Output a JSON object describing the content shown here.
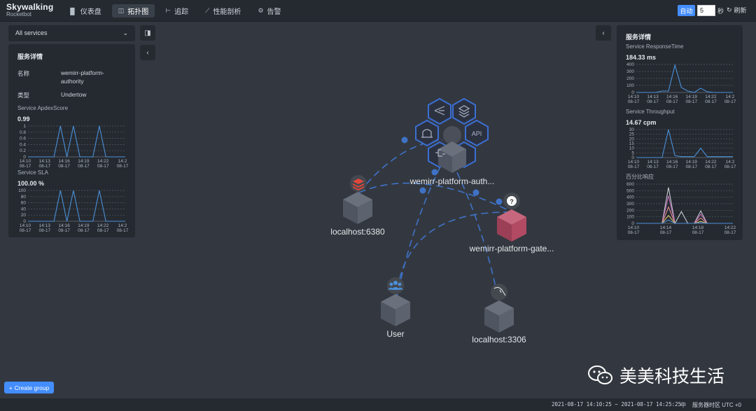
{
  "app": {
    "logo_main": "Skywalking",
    "logo_sub": "Rocketbot"
  },
  "nav": [
    {
      "label": "仪表盘",
      "icon": "bar-chart-icon",
      "glyph": "▐▌",
      "active": false
    },
    {
      "label": "拓扑图",
      "icon": "topology-icon",
      "glyph": "◫",
      "active": true
    },
    {
      "label": "追踪",
      "icon": "trace-icon",
      "glyph": "⊢",
      "active": false
    },
    {
      "label": "性能剖析",
      "icon": "profile-icon",
      "glyph": "⟋",
      "active": false
    },
    {
      "label": "告警",
      "icon": "alarm-icon",
      "glyph": "⚙",
      "active": false
    }
  ],
  "toolbar": {
    "auto_label": "自动",
    "interval_value": "5",
    "seconds_label": "秒",
    "refresh_label": "刷新"
  },
  "left": {
    "select_value": "All services",
    "title": "服务详情",
    "name_key": "名称",
    "name_value_1": "wemirr-platform-",
    "name_value_2": "authority",
    "type_key": "类型",
    "type_value": "Undertow",
    "apdex_label": "Service ApdexScore",
    "apdex_value": "0.99",
    "apdex_yticks": [
      "1",
      "0.8",
      "0.6",
      "0.4",
      "0.2",
      "0"
    ],
    "sla_label": "Service SLA",
    "sla_value": "100.00 %",
    "sla_yticks": [
      "100",
      "80",
      "60",
      "40",
      "20",
      "0"
    ],
    "xticks": [
      "14:10",
      "14:13",
      "14:16",
      "14:19",
      "14:22",
      "14:2"
    ],
    "xdate": "08-17"
  },
  "chart_data": [
    {
      "type": "line",
      "title": "Service ApdexScore",
      "x": [
        "14:10",
        "14:11",
        "14:12",
        "14:13",
        "14:14",
        "14:15",
        "14:16",
        "14:17",
        "14:18",
        "14:19",
        "14:20",
        "14:21",
        "14:22",
        "14:23",
        "14:24",
        "14:25"
      ],
      "values": [
        0,
        0,
        0,
        0,
        0,
        1,
        0,
        1,
        0,
        0,
        0,
        1,
        0,
        0,
        0,
        0
      ],
      "ylim": [
        0,
        1
      ]
    },
    {
      "type": "line",
      "title": "Service SLA",
      "x": [
        "14:10",
        "14:11",
        "14:12",
        "14:13",
        "14:14",
        "14:15",
        "14:16",
        "14:17",
        "14:18",
        "14:19",
        "14:20",
        "14:21",
        "14:22",
        "14:23",
        "14:24",
        "14:25"
      ],
      "values": [
        0,
        0,
        0,
        0,
        0,
        100,
        0,
        100,
        0,
        0,
        0,
        100,
        0,
        0,
        0,
        0
      ],
      "ylim": [
        0,
        100
      ]
    },
    {
      "type": "line",
      "title": "Service ResponseTime",
      "x": [
        "14:10",
        "14:11",
        "14:12",
        "14:13",
        "14:14",
        "14:15",
        "14:16",
        "14:17",
        "14:18",
        "14:19",
        "14:20",
        "14:21",
        "14:22",
        "14:23",
        "14:24",
        "14:25"
      ],
      "values": [
        0,
        0,
        0,
        0,
        20,
        20,
        390,
        70,
        20,
        0,
        60,
        10,
        0,
        0,
        0,
        0
      ],
      "ylim": [
        0,
        400
      ]
    },
    {
      "type": "line",
      "title": "Service Throughput",
      "x": [
        "14:10",
        "14:11",
        "14:12",
        "14:13",
        "14:14",
        "14:15",
        "14:16",
        "14:17",
        "14:18",
        "14:19",
        "14:20",
        "14:21",
        "14:22",
        "14:23",
        "14:24",
        "14:25"
      ],
      "values": [
        0,
        0,
        0,
        0,
        0,
        30,
        2,
        1,
        1,
        1,
        10,
        1,
        1,
        1,
        1,
        1
      ],
      "ylim": [
        0,
        30
      ]
    },
    {
      "type": "line",
      "title": "百分比响应",
      "x": [
        "14:10",
        "14:11",
        "14:12",
        "14:13",
        "14:14",
        "14:15",
        "14:16",
        "14:17",
        "14:18",
        "14:19",
        "14:20",
        "14:21",
        "14:22",
        "14:23",
        "14:24",
        "14:25"
      ],
      "series": [
        {
          "values": [
            0,
            0,
            0,
            0,
            0,
            550,
            0,
            180,
            0,
            0,
            190,
            0,
            0,
            0,
            0,
            0
          ],
          "color": "#c9cdd2"
        },
        {
          "values": [
            0,
            0,
            0,
            0,
            0,
            420,
            0,
            0,
            0,
            0,
            140,
            0,
            0,
            0,
            0,
            0
          ],
          "color": "#c26fb8"
        },
        {
          "values": [
            0,
            0,
            0,
            0,
            0,
            250,
            0,
            0,
            0,
            0,
            80,
            0,
            0,
            0,
            0,
            0
          ],
          "color": "#e08e8e"
        },
        {
          "values": [
            0,
            0,
            0,
            0,
            0,
            120,
            0,
            0,
            0,
            0,
            30,
            0,
            0,
            0,
            0,
            0
          ],
          "color": "#d8c36a"
        },
        {
          "values": [
            0,
            0,
            0,
            0,
            0,
            50,
            0,
            0,
            0,
            0,
            10,
            0,
            0,
            0,
            0,
            0
          ],
          "color": "#4a90d9"
        }
      ],
      "ylim": [
        0,
        600
      ]
    }
  ],
  "right": {
    "title": "服务详情",
    "rt_label": "Service ResponseTime",
    "rt_value": "184.33 ms",
    "rt_yticks": [
      "400",
      "300",
      "200",
      "100",
      "0"
    ],
    "tp_label": "Service Throughput",
    "tp_value": "14.67 cpm",
    "tp_yticks": [
      "30",
      "25",
      "20",
      "15",
      "10",
      "5",
      "0"
    ],
    "pct_label": "百分比响应",
    "pct_yticks": [
      "600",
      "500",
      "400",
      "300",
      "200",
      "100",
      "0"
    ],
    "xticks": [
      "14:10",
      "14:13",
      "14:16",
      "14:19",
      "14:22",
      "14:2"
    ],
    "pct_xticks": [
      "14:10",
      "14:14",
      "14:18",
      "14:22"
    ],
    "xdate": "08-17"
  },
  "topology": {
    "nodes": {
      "authority": "wemirr-platform-auth...",
      "redis": "localhost:6380",
      "gateway": "wemirr-platform-gate...",
      "user": "User",
      "mysql": "localhost:3306"
    },
    "unknown_badge": "?",
    "api_label": "API"
  },
  "create_group_label": "Create group",
  "status": {
    "time_range": "2021-08-17 14:10:25 ~ 2021-08-17 14:25:25",
    "lang": "中",
    "timezone": "服务器时区 UTC +0"
  },
  "watermark": "美美科技生活",
  "colors": {
    "accent": "#448dfe",
    "line": "#4a90d9",
    "hex_stroke": "#3b6fd3",
    "gateway": "#b24a63"
  }
}
